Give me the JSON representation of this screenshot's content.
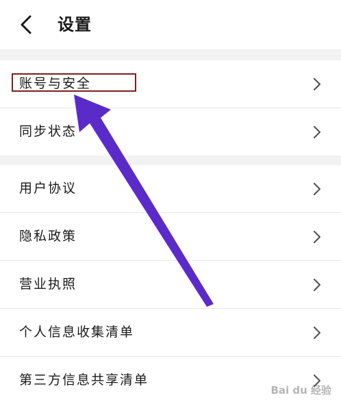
{
  "header": {
    "title": "设置",
    "back_icon": "chevron-left-icon"
  },
  "group1": [
    {
      "label": "账号与安全",
      "icon": "chevron-right-icon"
    },
    {
      "label": "同步状态",
      "icon": "chevron-right-icon"
    }
  ],
  "group2": [
    {
      "label": "用户协议",
      "icon": "chevron-right-icon"
    },
    {
      "label": "隐私政策",
      "icon": "chevron-right-icon"
    },
    {
      "label": "营业执照",
      "icon": "chevron-right-icon"
    },
    {
      "label": "个人信息收集清单",
      "icon": "chevron-right-icon"
    },
    {
      "label": "第三方信息共享清单",
      "icon": "chevron-right-icon"
    }
  ],
  "annotation": {
    "highlight_color": "#7a1f1f",
    "arrow_color": "#5b2bc9"
  },
  "watermark": {
    "text": "Bai du 经验"
  },
  "colors": {
    "background": "#ffffff",
    "section_gap": "#f2f2f2",
    "divider": "#e6e6e6",
    "text": "#1a1a1a",
    "chevron": "#555555"
  }
}
